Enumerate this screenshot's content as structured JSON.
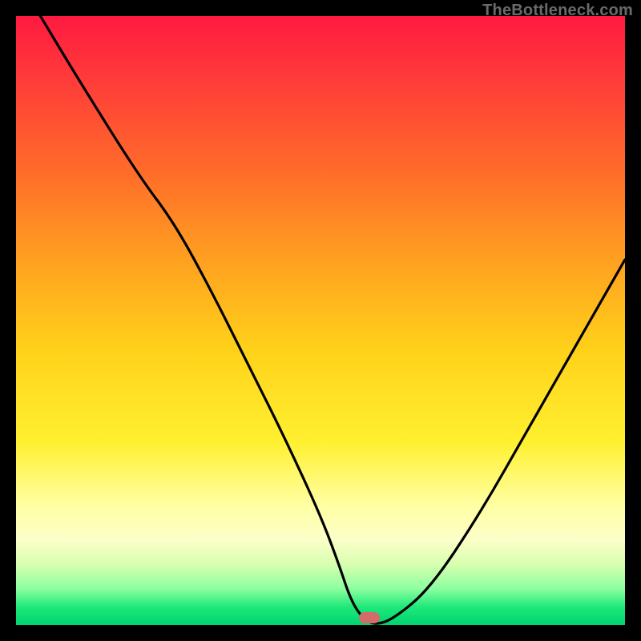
{
  "attribution": "TheBottleneck.com",
  "chart_data": {
    "type": "line",
    "title": "",
    "xlabel": "",
    "ylabel": "",
    "xlim": [
      0,
      100
    ],
    "ylim": [
      0,
      100
    ],
    "series": [
      {
        "name": "curve",
        "x": [
          4,
          10,
          20,
          26,
          32,
          38,
          44,
          50,
          53,
          55,
          57,
          59,
          62,
          68,
          76,
          84,
          92,
          100
        ],
        "values": [
          100,
          90,
          74,
          66,
          55,
          43,
          31,
          18,
          10,
          4,
          1,
          0,
          1,
          6,
          18,
          32,
          46,
          60
        ]
      }
    ],
    "marker": {
      "x": 58,
      "y": 1.2
    },
    "gradient_stops": [
      {
        "pos": 0,
        "color": "#ff1a40"
      },
      {
        "pos": 25,
        "color": "#ff6a2a"
      },
      {
        "pos": 55,
        "color": "#ffd21a"
      },
      {
        "pos": 80,
        "color": "#ffffa0"
      },
      {
        "pos": 100,
        "color": "#00d470"
      }
    ]
  }
}
